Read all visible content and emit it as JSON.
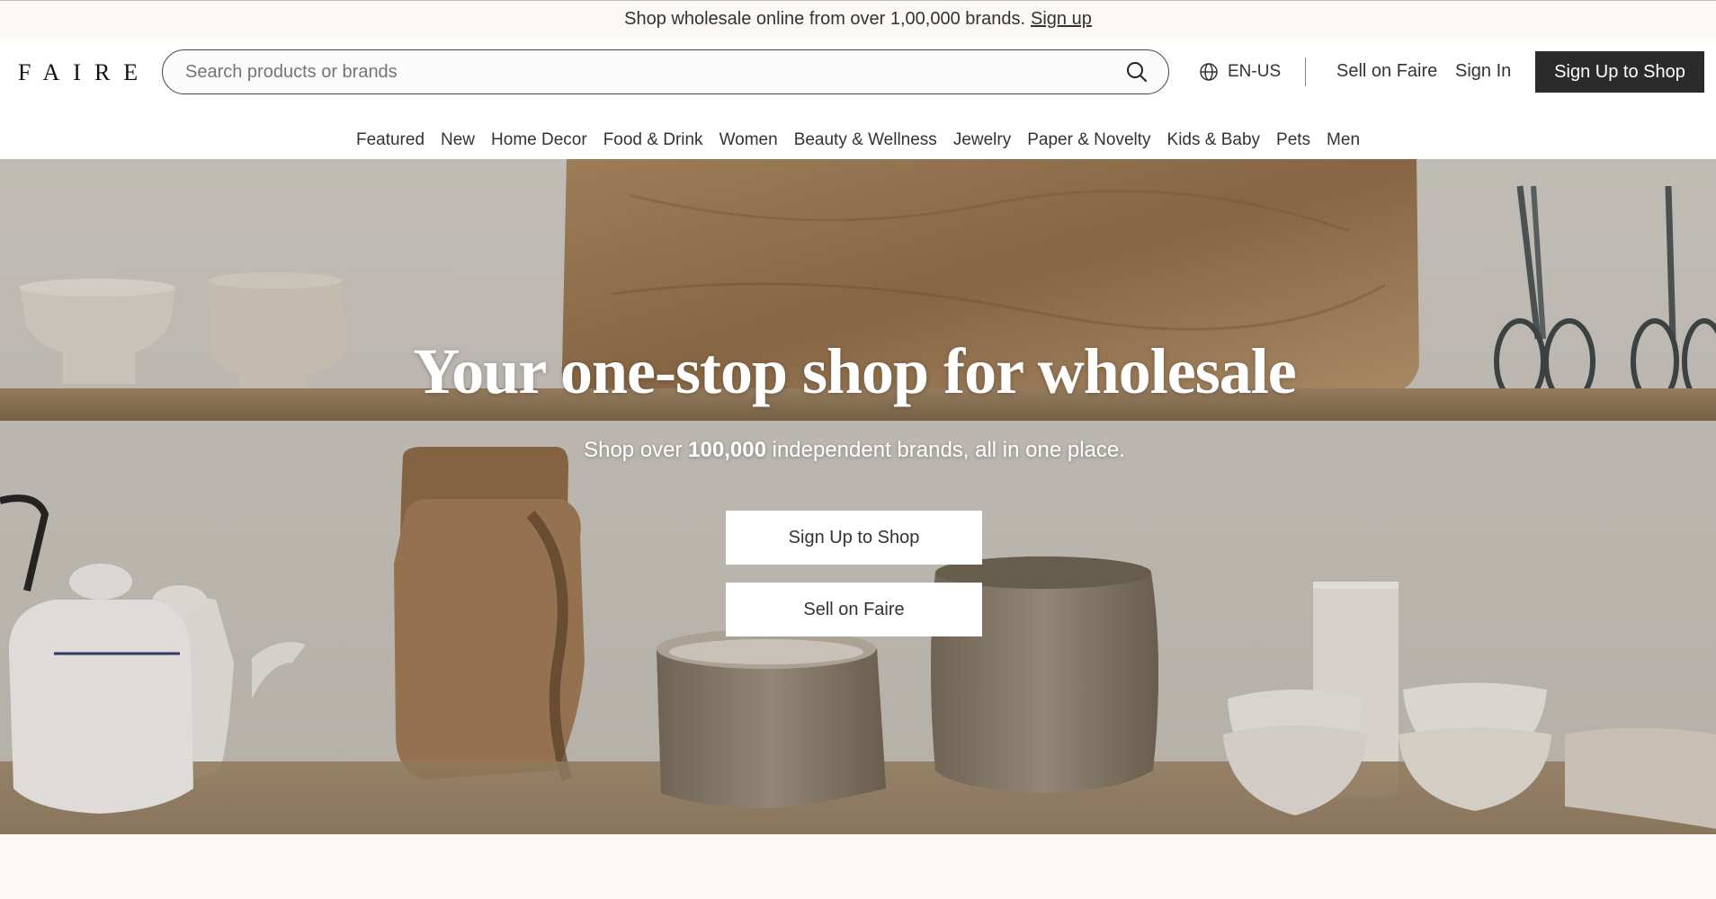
{
  "announcement": {
    "text": "Shop wholesale online from over 1,00,000 brands.",
    "link": "Sign up"
  },
  "header": {
    "logo": "FAIRE",
    "search_placeholder": "Search products or brands",
    "language": "EN-US",
    "sell_link": "Sell on Faire",
    "sign_in": "Sign In",
    "cta": "Sign Up to Shop"
  },
  "categories": [
    "Featured",
    "New",
    "Home Decor",
    "Food & Drink",
    "Women",
    "Beauty & Wellness",
    "Jewelry",
    "Paper & Novelty",
    "Kids & Baby",
    "Pets",
    "Men"
  ],
  "hero": {
    "title": "Your one-stop shop for wholesale",
    "subtitle_prefix": "Shop over",
    "subtitle_bold": "100,000",
    "subtitle_suffix": "independent brands, all in one place.",
    "primary_button": "Sign Up to Shop",
    "secondary_button": "Sell on Faire"
  },
  "colors": {
    "background": "#fbf8f5",
    "cta_dark": "#2b2b2b",
    "text": "#333333"
  }
}
